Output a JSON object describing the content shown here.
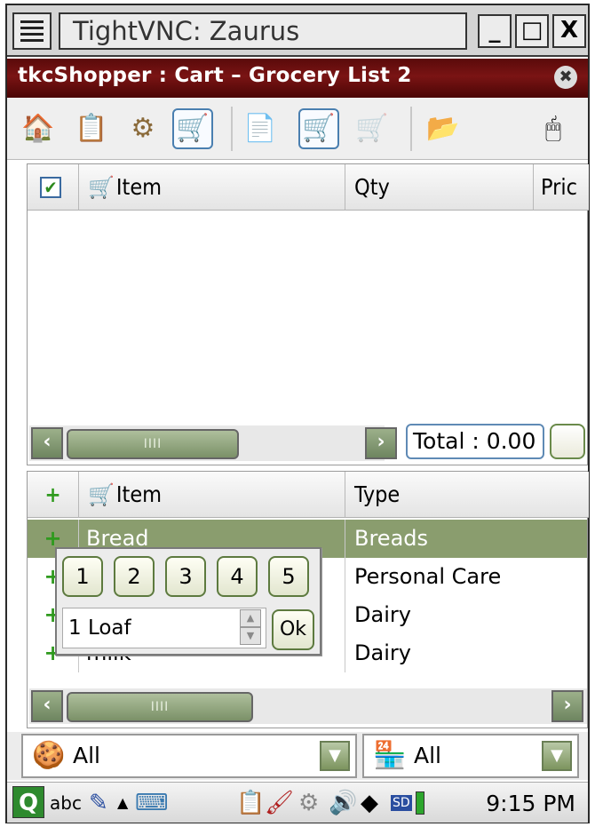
{
  "window": {
    "title": "TightVNC: Zaurus",
    "minimize": "_",
    "maximize": "□",
    "close": "X"
  },
  "app": {
    "title": "tkcShopper : Cart – Grocery List 2",
    "close_glyph": "✖"
  },
  "toolbar": {
    "items": [
      {
        "name": "home-icon",
        "glyph": "🏠"
      },
      {
        "name": "list-icon",
        "glyph": "📋"
      },
      {
        "name": "preferences-icon",
        "glyph": "⚙"
      },
      {
        "name": "cart-icon",
        "glyph": "🛒"
      },
      {
        "name": "new-document-icon",
        "glyph": "📄"
      },
      {
        "name": "add-to-cart-icon",
        "glyph": "🛒"
      },
      {
        "name": "checkout-icon",
        "glyph": "🛒"
      },
      {
        "name": "open-folder-icon",
        "glyph": "📂"
      },
      {
        "name": "mouse-icon",
        "glyph": "🖱"
      }
    ]
  },
  "cart": {
    "columns": [
      "Item",
      "Qty",
      "Pric"
    ],
    "checkbox": "✔",
    "rows": [],
    "total_label": "Total : 0.00",
    "scroll_left": "‹",
    "scroll_right": "›",
    "thumb_grip": "IIII"
  },
  "items": {
    "columns": [
      "Item",
      "Type"
    ],
    "rows": [
      {
        "item": "Bread",
        "type": "Breads",
        "selected": true
      },
      {
        "item": "",
        "type": "Personal Care"
      },
      {
        "item": "",
        "type": "Dairy"
      },
      {
        "item": "milk",
        "type": "Dairy"
      }
    ],
    "scroll_left": "‹",
    "scroll_right": "›",
    "thumb_grip": "IIII"
  },
  "popup": {
    "buttons": [
      "1",
      "2",
      "3",
      "4",
      "5"
    ],
    "quantity_value": "1 Loaf",
    "ok_label": "Ok"
  },
  "filters": {
    "left": {
      "value": "All",
      "icon": "category-icon"
    },
    "right": {
      "value": "All",
      "icon": "store-icon"
    },
    "dropdown_glyph": "▼"
  },
  "taskbar": {
    "launcher": "Q",
    "input_method": "abc",
    "clock": "9:15 PM"
  }
}
